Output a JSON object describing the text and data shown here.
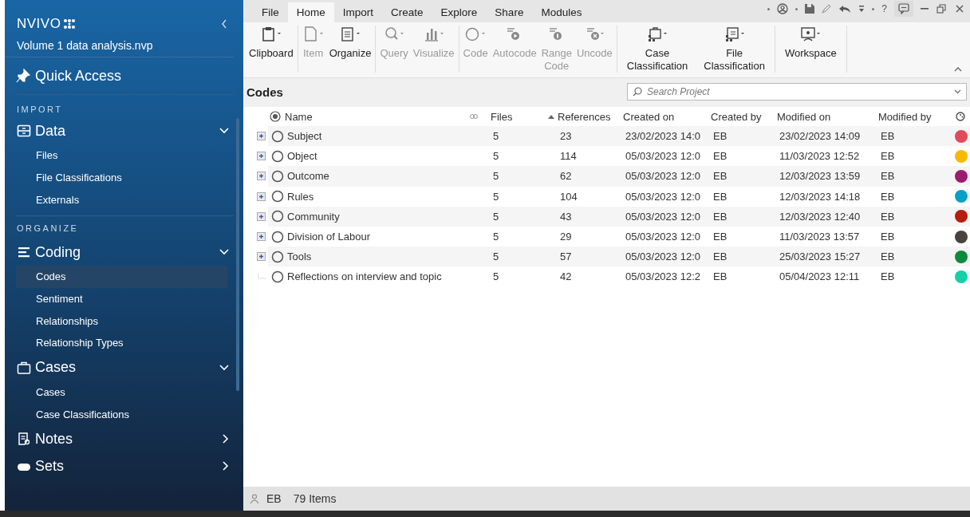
{
  "sidebar": {
    "logo": "NVIVO",
    "project": "Volume 1 data analysis.nvp",
    "quick_access": "Quick Access",
    "sections": [
      {
        "heading": "IMPORT",
        "groups": [
          {
            "label": "Data",
            "expanded": true,
            "items": [
              {
                "label": "Files",
                "selected": false
              },
              {
                "label": "File Classifications",
                "selected": false
              },
              {
                "label": "Externals",
                "selected": false
              }
            ]
          }
        ]
      },
      {
        "heading": "ORGANIZE",
        "groups": [
          {
            "label": "Coding",
            "expanded": true,
            "items": [
              {
                "label": "Codes",
                "selected": true
              },
              {
                "label": "Sentiment",
                "selected": false
              },
              {
                "label": "Relationships",
                "selected": false
              },
              {
                "label": "Relationship Types",
                "selected": false
              }
            ]
          },
          {
            "label": "Cases",
            "expanded": true,
            "items": [
              {
                "label": "Cases",
                "selected": false
              },
              {
                "label": "Case Classifications",
                "selected": false
              }
            ]
          },
          {
            "label": "Notes",
            "expanded": false
          },
          {
            "label": "Sets",
            "expanded": false
          }
        ]
      }
    ]
  },
  "ribbon": {
    "tabs": [
      {
        "label": "File",
        "selected": false
      },
      {
        "label": "Home",
        "selected": true
      },
      {
        "label": "Import",
        "selected": false
      },
      {
        "label": "Create",
        "selected": false
      },
      {
        "label": "Explore",
        "selected": false
      },
      {
        "label": "Share",
        "selected": false
      },
      {
        "label": "Modules",
        "selected": false
      }
    ],
    "help": "?",
    "groups": [
      [
        {
          "label": "Clipboard",
          "disabled": false
        }
      ],
      [
        {
          "label": "Item",
          "disabled": true
        },
        {
          "label": "Organize",
          "disabled": false
        }
      ],
      [
        {
          "label": "Query",
          "disabled": true
        },
        {
          "label": "Visualize",
          "disabled": true
        }
      ],
      [
        {
          "label": "Code",
          "disabled": true
        },
        {
          "label": "Autocode",
          "disabled": true
        },
        {
          "label": "Range\nCode",
          "disabled": true
        },
        {
          "label": "Uncode",
          "disabled": true
        }
      ],
      [
        {
          "label": "Case\nClassification",
          "disabled": false
        },
        {
          "label": "File\nClassification",
          "disabled": false
        }
      ],
      [
        {
          "label": "Workspace",
          "disabled": false
        }
      ]
    ]
  },
  "view": {
    "title": "Codes",
    "search": {
      "placeholder": "Search Project"
    }
  },
  "table": {
    "columns": [
      {
        "label": "Name",
        "sorted": false
      },
      {
        "label": "Files",
        "sorted": false
      },
      {
        "label": "References",
        "sorted": true
      },
      {
        "label": "Created on",
        "sorted": false
      },
      {
        "label": "Created by",
        "sorted": false
      },
      {
        "label": "Modified on",
        "sorted": false
      },
      {
        "label": "Modified by",
        "sorted": false
      }
    ],
    "rows": [
      {
        "expandable": true,
        "name": "Subject",
        "files": "5",
        "references": "23",
        "created_on": "23/02/2023 14:0",
        "created_by": "EB",
        "modified_on": "23/02/2023 14:09",
        "modified_by": "EB",
        "color": "#e04a5a"
      },
      {
        "expandable": true,
        "name": "Object",
        "files": "5",
        "references": "114",
        "created_on": "05/03/2023 12:0",
        "created_by": "EB",
        "modified_on": "11/03/2023 12:52",
        "modified_by": "EB",
        "color": "#f7b900"
      },
      {
        "expandable": true,
        "name": "Outcome",
        "files": "5",
        "references": "62",
        "created_on": "05/03/2023 12:0",
        "created_by": "EB",
        "modified_on": "12/03/2023 13:59",
        "modified_by": "EB",
        "color": "#9b1c6f"
      },
      {
        "expandable": true,
        "name": "Rules",
        "files": "5",
        "references": "104",
        "created_on": "05/03/2023 12:0",
        "created_by": "EB",
        "modified_on": "12/03/2023 14:18",
        "modified_by": "EB",
        "color": "#08a1c4"
      },
      {
        "expandable": true,
        "name": "Community",
        "files": "5",
        "references": "43",
        "created_on": "05/03/2023 12:0",
        "created_by": "EB",
        "modified_on": "12/03/2023 12:40",
        "modified_by": "EB",
        "color": "#b71c0c"
      },
      {
        "expandable": true,
        "name": "Division of Labour",
        "files": "5",
        "references": "29",
        "created_on": "05/03/2023 12:0",
        "created_by": "EB",
        "modified_on": "11/03/2023 13:57",
        "modified_by": "EB",
        "color": "#4a423d"
      },
      {
        "expandable": true,
        "name": "Tools",
        "files": "5",
        "references": "57",
        "created_on": "05/03/2023 12:0",
        "created_by": "EB",
        "modified_on": "25/03/2023 15:27",
        "modified_by": "EB",
        "color": "#0e8a3c"
      },
      {
        "expandable": false,
        "name": "Reflections on interview and topic",
        "files": "5",
        "references": "42",
        "created_on": "05/03/2023 12:2",
        "created_by": "EB",
        "modified_on": "05/04/2023 12:11",
        "modified_by": "EB",
        "color": "#14d0a8"
      }
    ]
  },
  "status_bar": {
    "user": "EB",
    "count": "79 Items"
  }
}
